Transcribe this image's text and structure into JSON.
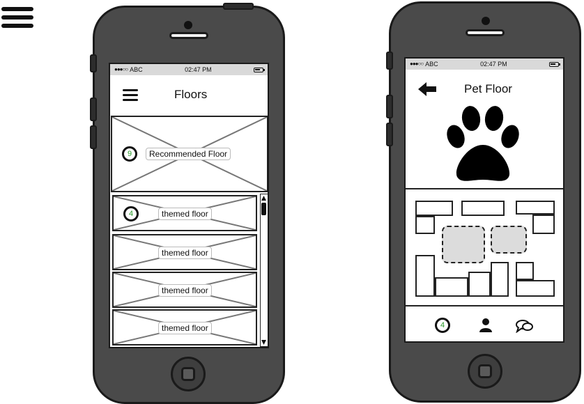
{
  "left_phone": {
    "status": {
      "carrier": "ABC",
      "time": "02:47 PM"
    },
    "header": {
      "title": "Floors"
    },
    "recommended": {
      "badge": "9",
      "label": "Recommended Floor"
    },
    "floors": [
      {
        "badge": "4",
        "label": "themed floor"
      },
      {
        "label": "themed floor"
      },
      {
        "label": "themed floor"
      },
      {
        "label": "themed floor"
      }
    ]
  },
  "right_phone": {
    "status": {
      "carrier": "ABC",
      "time": "02:47 PM"
    },
    "header": {
      "title": "Pet Floor"
    },
    "bottom_nav": {
      "badge": "4"
    }
  },
  "icons": {
    "corner": "menu-icon",
    "left_header": "menu-icon",
    "right_header": "back-arrow-icon",
    "hero": "paw-icon",
    "nav": [
      "badge",
      "user-icon",
      "chat-icon"
    ]
  },
  "colors": {
    "phone": "#4a4a4a",
    "outline": "#1a1a1a",
    "status_bar": "#d9d9d9",
    "badge_text": "#2a9a2a",
    "booth_fill": "#dcdcdc"
  }
}
